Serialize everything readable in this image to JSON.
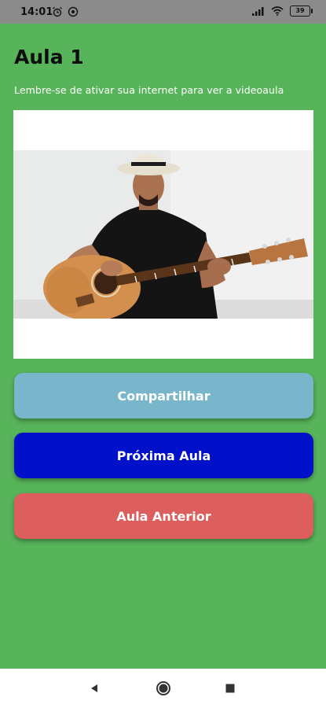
{
  "status_bar": {
    "time": "14:01",
    "battery": "39",
    "icons": [
      "alarm-icon",
      "do-not-disturb-icon",
      "signal-icon",
      "wifi-icon",
      "battery-icon"
    ]
  },
  "page": {
    "title": "Aula 1",
    "hint": "Lembre-se de ativar sua internet para ver a videoaula"
  },
  "video": {
    "description_icon": "video-thumbnail-guitar-player"
  },
  "buttons": {
    "share_label": "Compartilhar",
    "next_label": "Próxima Aula",
    "previous_label": "Aula Anterior"
  },
  "colors": {
    "background": "#57b45a",
    "share": "#79b6cb",
    "next": "#0110c9",
    "previous": "#dc5e5d"
  },
  "nav_bar": {
    "icons": [
      "back-icon",
      "home-icon",
      "recents-icon"
    ]
  }
}
